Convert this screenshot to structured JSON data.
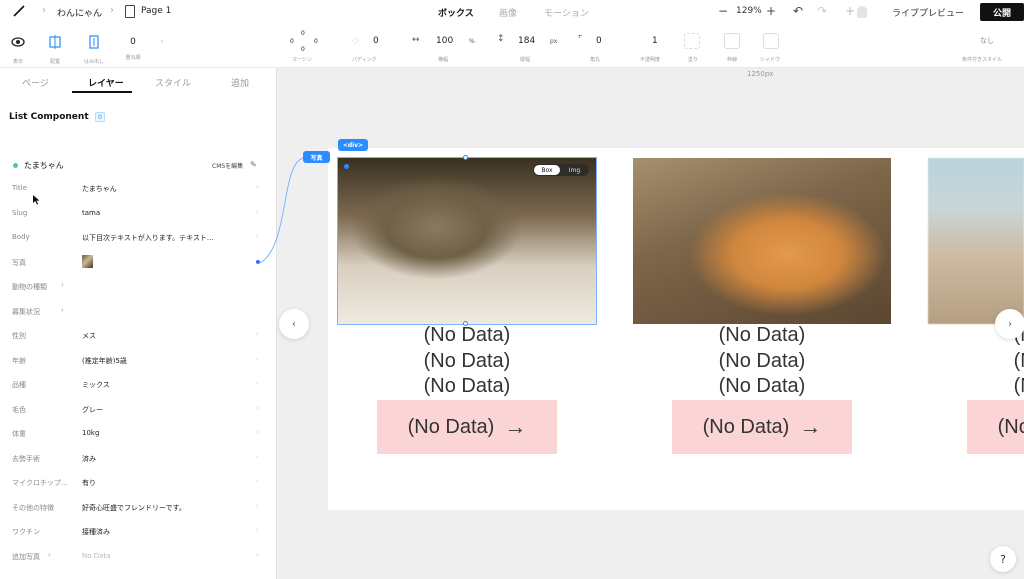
{
  "topbar": {
    "breadcrumb": [
      "わんにゃん",
      "Page 1"
    ],
    "mode_tabs": [
      {
        "label": "ボックス",
        "active": true
      },
      {
        "label": "画像",
        "active": false
      },
      {
        "label": "モーション",
        "active": false
      }
    ],
    "zoom": "129%",
    "zoom_minus": "−",
    "zoom_plus": "+",
    "add_plus": "+",
    "undo": "↶",
    "redo": "↷",
    "live_preview": "ライブプレビュー",
    "publish": "公開"
  },
  "propbar": {
    "items": [
      {
        "label": "表示"
      },
      {
        "label": "配置"
      },
      {
        "label": "はみ出し"
      },
      {
        "label": "重ね順",
        "value": "0"
      }
    ],
    "margin": {
      "label": "マージン",
      "values": [
        "0",
        "0",
        "0",
        "0"
      ]
    },
    "padding": {
      "label": "パディング",
      "value": "0"
    },
    "width": {
      "label": "横幅",
      "value": "100",
      "unit": "%"
    },
    "height": {
      "label": "縦幅",
      "value": "184",
      "unit": "px"
    },
    "radius": {
      "label": "角丸",
      "value": "0"
    },
    "opacity": {
      "label": "不透明度",
      "value": "1"
    },
    "extras": [
      "塗り",
      "枠線",
      "シャドウ"
    ],
    "conditional": {
      "label": "条件付きスタイル",
      "value": "なし"
    }
  },
  "panel": {
    "tabs": [
      {
        "label": "ページ",
        "active": false
      },
      {
        "label": "レイヤー",
        "active": true
      },
      {
        "label": "スタイル",
        "active": false
      },
      {
        "label": "追加",
        "active": false
      }
    ],
    "component_title": "List Component",
    "component_badge": "0",
    "item_name": "たまちゃん",
    "cms_edit": "CMSを編集",
    "fields": [
      {
        "label": "Title",
        "value": "たまちゃん"
      },
      {
        "label": "Slug",
        "value": "tama"
      },
      {
        "label": "Body",
        "value": "以下目次テキストが入ります。テキスト..."
      },
      {
        "label": "写真",
        "value": ""
      },
      {
        "label": "動物の種類",
        "value": ""
      },
      {
        "label": "募集状況",
        "value": ""
      },
      {
        "label": "性別",
        "value": "メス"
      },
      {
        "label": "年齢",
        "value": "(推定年齢)5歳"
      },
      {
        "label": "品種",
        "value": "ミックス"
      },
      {
        "label": "毛色",
        "value": "グレー"
      },
      {
        "label": "体重",
        "value": "10kg"
      },
      {
        "label": "去勢手術",
        "value": "済み"
      },
      {
        "label": "マイクロチップ...",
        "value": "有り"
      },
      {
        "label": "その他の特徴",
        "value": "好奇心旺盛でフレンドリーです。"
      },
      {
        "label": "ワクチン",
        "value": "接種済み"
      },
      {
        "label": "追加写真",
        "value": "No Data"
      }
    ]
  },
  "canvas": {
    "ruler_label": "1250px",
    "tag_photo": "写真",
    "tag_div": "<div>",
    "toggle": {
      "box": "Box",
      "img": "Img"
    },
    "cards": [
      {
        "lines": [
          "(No Data)",
          "(No Data)",
          "(No Data)"
        ],
        "cta": "(No Data)",
        "arrow": "→"
      },
      {
        "lines": [
          "(No Data)",
          "(No Data)",
          "(No Data)"
        ],
        "cta": "(No Data)",
        "arrow": "→"
      },
      {
        "lines": [
          "(No Data)",
          "(No Data)",
          "(No Data)"
        ],
        "cta": "(No Data)",
        "arrow": "→"
      }
    ],
    "nav_prev": "‹",
    "nav_next": "›",
    "help": "?"
  },
  "colors": {
    "accent": "#2a8cff",
    "cta_bg": "#fbd5d5",
    "publish_bg": "#111111",
    "status_dot": "#3dd68c"
  }
}
